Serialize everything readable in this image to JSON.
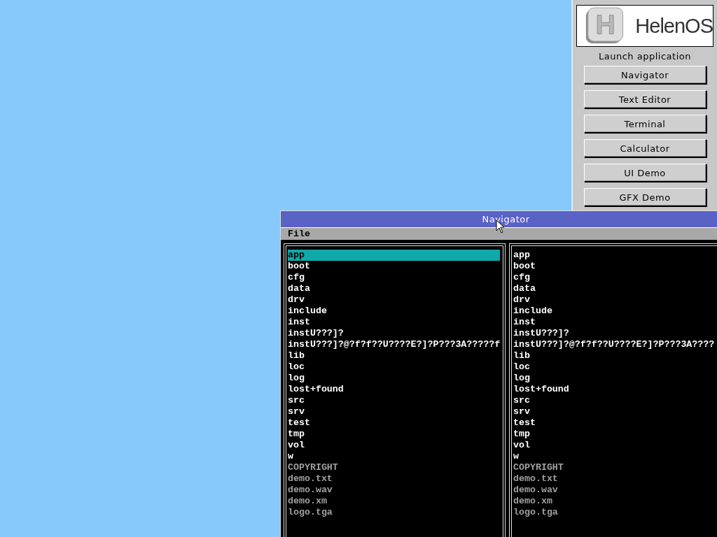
{
  "launcher": {
    "logo_text": "HelenOS",
    "heading": "Launch application",
    "buttons": [
      "Navigator",
      "Text Editor",
      "Terminal",
      "Calculator",
      "UI Demo",
      "GFX Demo"
    ]
  },
  "navigator": {
    "title": "Navigator",
    "menu": [
      "File"
    ],
    "panels": [
      {
        "entries": [
          {
            "name": "app",
            "kind": "dir",
            "selected": true
          },
          {
            "name": "boot",
            "kind": "dir",
            "selected": false
          },
          {
            "name": "cfg",
            "kind": "dir",
            "selected": false
          },
          {
            "name": "data",
            "kind": "dir",
            "selected": false
          },
          {
            "name": "drv",
            "kind": "dir",
            "selected": false
          },
          {
            "name": "include",
            "kind": "dir",
            "selected": false
          },
          {
            "name": "inst",
            "kind": "dir",
            "selected": false
          },
          {
            "name": "instU???]?",
            "kind": "dir",
            "selected": false
          },
          {
            "name": "instU???]?@?f?f??U????E?]?P???3A?????f",
            "kind": "dir",
            "selected": false
          },
          {
            "name": "lib",
            "kind": "dir",
            "selected": false
          },
          {
            "name": "loc",
            "kind": "dir",
            "selected": false
          },
          {
            "name": "log",
            "kind": "dir",
            "selected": false
          },
          {
            "name": "lost+found",
            "kind": "dir",
            "selected": false
          },
          {
            "name": "src",
            "kind": "dir",
            "selected": false
          },
          {
            "name": "srv",
            "kind": "dir",
            "selected": false
          },
          {
            "name": "test",
            "kind": "dir",
            "selected": false
          },
          {
            "name": "tmp",
            "kind": "dir",
            "selected": false
          },
          {
            "name": "vol",
            "kind": "dir",
            "selected": false
          },
          {
            "name": "w",
            "kind": "dir",
            "selected": false
          },
          {
            "name": "COPYRIGHT",
            "kind": "file",
            "selected": false
          },
          {
            "name": "demo.txt",
            "kind": "file",
            "selected": false
          },
          {
            "name": "demo.wav",
            "kind": "file",
            "selected": false
          },
          {
            "name": "demo.xm",
            "kind": "file",
            "selected": false
          },
          {
            "name": "logo.tga",
            "kind": "file",
            "selected": false
          }
        ]
      },
      {
        "entries": [
          {
            "name": "app",
            "kind": "dir",
            "selected": false
          },
          {
            "name": "boot",
            "kind": "dir",
            "selected": false
          },
          {
            "name": "cfg",
            "kind": "dir",
            "selected": false
          },
          {
            "name": "data",
            "kind": "dir",
            "selected": false
          },
          {
            "name": "drv",
            "kind": "dir",
            "selected": false
          },
          {
            "name": "include",
            "kind": "dir",
            "selected": false
          },
          {
            "name": "inst",
            "kind": "dir",
            "selected": false
          },
          {
            "name": "instU???]?",
            "kind": "dir",
            "selected": false
          },
          {
            "name": "instU???]?@?f?f??U????E?]?P???3A????",
            "kind": "dir",
            "selected": false
          },
          {
            "name": "lib",
            "kind": "dir",
            "selected": false
          },
          {
            "name": "loc",
            "kind": "dir",
            "selected": false
          },
          {
            "name": "log",
            "kind": "dir",
            "selected": false
          },
          {
            "name": "lost+found",
            "kind": "dir",
            "selected": false
          },
          {
            "name": "src",
            "kind": "dir",
            "selected": false
          },
          {
            "name": "srv",
            "kind": "dir",
            "selected": false
          },
          {
            "name": "test",
            "kind": "dir",
            "selected": false
          },
          {
            "name": "tmp",
            "kind": "dir",
            "selected": false
          },
          {
            "name": "vol",
            "kind": "dir",
            "selected": false
          },
          {
            "name": "w",
            "kind": "dir",
            "selected": false
          },
          {
            "name": "COPYRIGHT",
            "kind": "file",
            "selected": false
          },
          {
            "name": "demo.txt",
            "kind": "file",
            "selected": false
          },
          {
            "name": "demo.wav",
            "kind": "file",
            "selected": false
          },
          {
            "name": "demo.xm",
            "kind": "file",
            "selected": false
          },
          {
            "name": "logo.tga",
            "kind": "file",
            "selected": false
          }
        ]
      }
    ]
  }
}
